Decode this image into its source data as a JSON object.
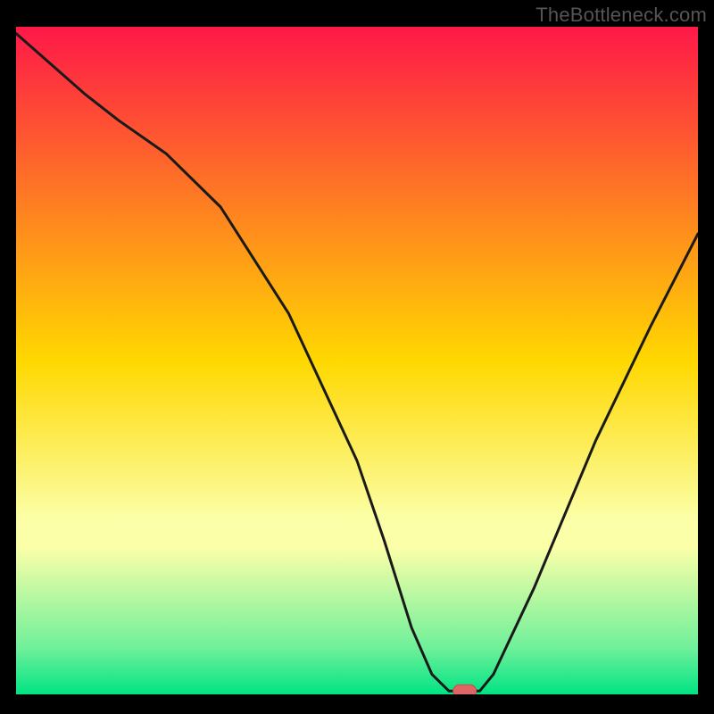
{
  "watermark": "TheBottleneck.com",
  "colors": {
    "top": "#fe1848",
    "mid": "#ffd800",
    "low_yellow": "#fbffa8",
    "green_start": "#70f09a",
    "green_end": "#00e484",
    "black": "#000000",
    "line": "#1a1a1a",
    "marker_fill": "#e06666",
    "marker_stroke": "#c05050"
  },
  "chart_data": {
    "type": "line",
    "title": "",
    "xlabel": "",
    "ylabel": "",
    "xlim": [
      0,
      100
    ],
    "ylim": [
      0,
      100
    ],
    "x": [
      0,
      10,
      15,
      22,
      30,
      40,
      50,
      54,
      58,
      61,
      63.5,
      68,
      70,
      76,
      85,
      93,
      100
    ],
    "values": [
      99,
      90,
      86,
      81,
      73,
      57,
      35,
      23,
      10,
      3,
      0.5,
      0.5,
      3,
      16,
      38,
      55,
      69
    ],
    "marker": {
      "x": 65.8,
      "y": 0.5
    }
  }
}
